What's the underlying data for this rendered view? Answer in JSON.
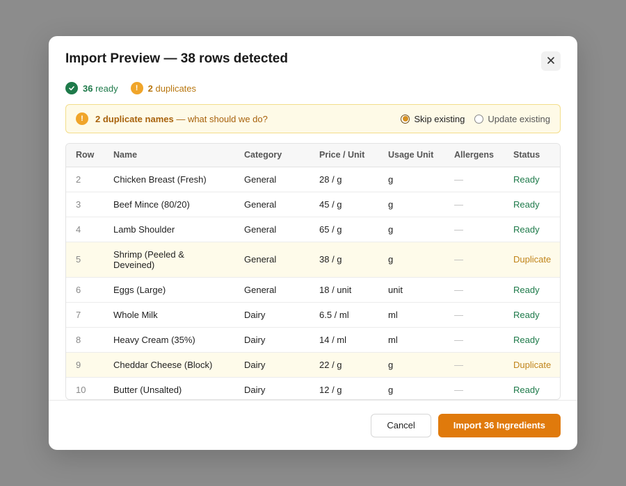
{
  "modal": {
    "title": "Import Preview — 38 rows detected",
    "close_icon": "close-icon"
  },
  "summary": {
    "ready_count": "36",
    "ready_label": "ready",
    "ready_icon": "check-icon",
    "duplicate_count": "2",
    "duplicate_label": "duplicates",
    "duplicate_icon": "warning-icon"
  },
  "banner": {
    "icon": "warning-icon",
    "bold_text": "2 duplicate names",
    "text": " — what should we do?",
    "options": [
      {
        "label": "Skip existing",
        "selected": true
      },
      {
        "label": "Update existing",
        "selected": false
      }
    ]
  },
  "table": {
    "columns": [
      "Row",
      "Name",
      "Category",
      "Price / Unit",
      "Usage Unit",
      "Allergens",
      "Status"
    ],
    "rows": [
      {
        "row": "2",
        "name": "Chicken Breast (Fresh)",
        "category": "General",
        "price": "28 / g",
        "unit": "g",
        "allergens": "—",
        "status": "Ready"
      },
      {
        "row": "3",
        "name": "Beef Mince (80/20)",
        "category": "General",
        "price": "45 / g",
        "unit": "g",
        "allergens": "—",
        "status": "Ready"
      },
      {
        "row": "4",
        "name": "Lamb Shoulder",
        "category": "General",
        "price": "65 / g",
        "unit": "g",
        "allergens": "—",
        "status": "Ready"
      },
      {
        "row": "5",
        "name": "Shrimp (Peeled & Deveined)",
        "category": "General",
        "price": "38 / g",
        "unit": "g",
        "allergens": "—",
        "status": "Duplicate"
      },
      {
        "row": "6",
        "name": "Eggs (Large)",
        "category": "General",
        "price": "18 / unit",
        "unit": "unit",
        "allergens": "—",
        "status": "Ready"
      },
      {
        "row": "7",
        "name": "Whole Milk",
        "category": "Dairy",
        "price": "6.5 / ml",
        "unit": "ml",
        "allergens": "—",
        "status": "Ready"
      },
      {
        "row": "8",
        "name": "Heavy Cream (35%)",
        "category": "Dairy",
        "price": "14 / ml",
        "unit": "ml",
        "allergens": "—",
        "status": "Ready"
      },
      {
        "row": "9",
        "name": "Cheddar Cheese (Block)",
        "category": "Dairy",
        "price": "22 / g",
        "unit": "g",
        "allergens": "—",
        "status": "Duplicate"
      },
      {
        "row": "10",
        "name": "Butter (Unsalted)",
        "category": "Dairy",
        "price": "12 / g",
        "unit": "g",
        "allergens": "—",
        "status": "Ready"
      }
    ]
  },
  "footer": {
    "cancel_label": "Cancel",
    "import_label": "Import 36 Ingredients"
  },
  "colors": {
    "accent": "#e07a0c",
    "ready": "#1e7a4a",
    "duplicate": "#c0841a",
    "banner_bg": "#fefae7"
  }
}
